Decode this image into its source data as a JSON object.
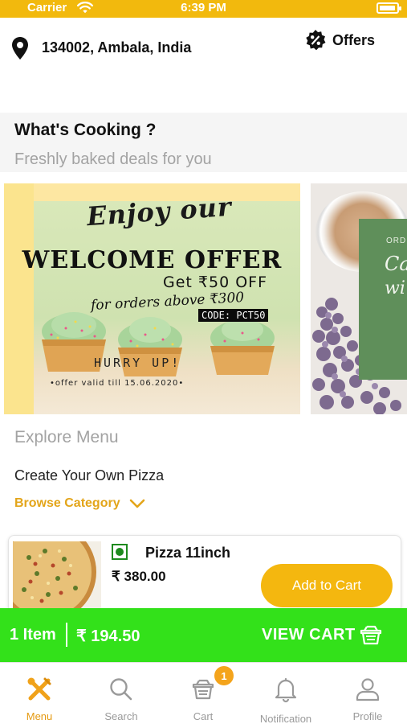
{
  "status_bar": {
    "carrier": "Carrier",
    "time": "6:39 PM",
    "battery_level": 0.95
  },
  "header": {
    "location": "134002, Ambala, India",
    "location_icon": "map-pin-icon",
    "offers_label": "Offers",
    "offers_icon": "discount-badge-icon"
  },
  "cooking_section": {
    "title": "What's Cooking ?",
    "subtitle": "Freshly baked deals for you"
  },
  "banners": [
    {
      "script_text": "Enjoy our",
      "headline": "WELCOME OFFER",
      "offer_line": "Get ₹50 OFF",
      "condition": "for orders above ₹300",
      "code": "CODE: PCT50",
      "hurry": "HURRY UP!",
      "validity": "•offer valid till 15.06.2020•"
    },
    {
      "small_text": "ORD",
      "script_line1": "Ca",
      "script_line2": "wi"
    }
  ],
  "explore": {
    "title": "Explore Menu",
    "category_name": "Create Your Own Pizza",
    "browse_label": "Browse Category"
  },
  "menu_items": [
    {
      "name": "Pizza 11inch",
      "price": "₹ 380.00",
      "veg": true,
      "add_label": "Add to Cart"
    }
  ],
  "cart_bar": {
    "count_label": "1 Item",
    "total": "₹ 194.50",
    "view_label": "VIEW CART"
  },
  "tab_bar": {
    "tabs": [
      {
        "label": "Menu",
        "icon": "menu-utensils-icon",
        "active": true
      },
      {
        "label": "Search",
        "icon": "search-icon",
        "active": false
      },
      {
        "label": "Cart",
        "icon": "cart-basket-icon",
        "active": false,
        "badge": "1"
      },
      {
        "label": "Notification",
        "icon": "bell-icon",
        "active": false
      },
      {
        "label": "Profile",
        "icon": "profile-icon",
        "active": false
      }
    ]
  },
  "colors": {
    "brand_yellow": "#f2b90d",
    "accent_orange": "#e59a12",
    "cart_green": "#33e11a",
    "veg_green": "#1e8a1e"
  }
}
